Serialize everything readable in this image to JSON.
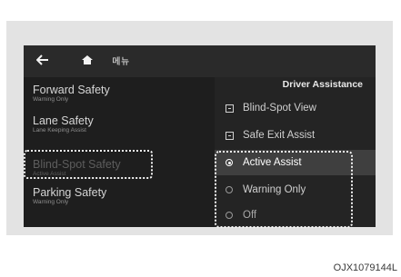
{
  "topbar": {
    "back_icon": "arrow-left-icon",
    "home_icon": "home-icon",
    "menu_label": "메뉴"
  },
  "left_menu": {
    "items": [
      {
        "title": "Forward Safety",
        "subtitle": "Warning Only",
        "selected": false
      },
      {
        "title": "Lane Safety",
        "subtitle": "Lane Keeping Assist",
        "selected": false
      },
      {
        "title": "Blind-Spot Safety",
        "subtitle": "Active Assist",
        "selected": true
      },
      {
        "title": "Parking Safety",
        "subtitle": "Warning Only",
        "selected": false
      }
    ]
  },
  "right_panel": {
    "title": "Driver Assistance",
    "options": [
      {
        "label": "Blind-Spot View",
        "control": "checkbox"
      },
      {
        "label": "Safe Exit Assist",
        "control": "checkbox"
      },
      {
        "label": "Active Assist",
        "control": "radio",
        "checked": true
      },
      {
        "label": "Warning Only",
        "control": "radio",
        "checked": false
      },
      {
        "label": "Off",
        "control": "radio",
        "checked": false
      }
    ]
  },
  "caption": "OJX1079144L",
  "colors": {
    "screen_bg": "#1e1e1e",
    "highlight_row": "#3f3f3f",
    "callout_border": "#f4f4f4"
  }
}
